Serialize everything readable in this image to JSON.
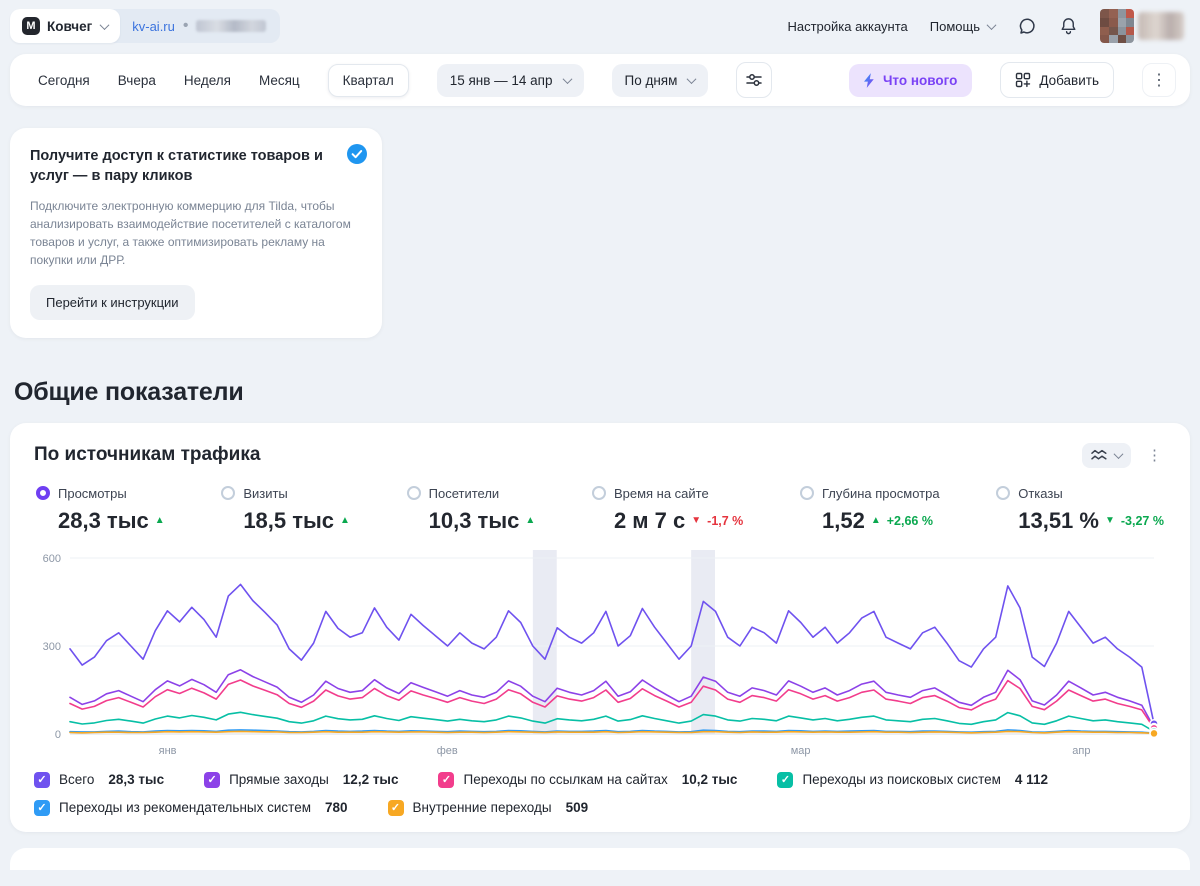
{
  "topbar": {
    "counter_name": "Ковчег",
    "logo_letter": "М",
    "site": "kv-ai.ru",
    "separator": "•",
    "account_settings": "Настройка аккаунта",
    "help": "Помощь"
  },
  "toolbar": {
    "periods": [
      "Сегодня",
      "Вчера",
      "Неделя",
      "Месяц",
      "Квартал"
    ],
    "active_period": "Квартал",
    "date_range": "15 янв — 14 апр",
    "granularity": "По дням",
    "whats_new": "Что нового",
    "add": "Добавить"
  },
  "promo": {
    "title": "Получите доступ к статистике товаров и услуг — в пару кликов",
    "body": "Подключите электронную коммерцию для Tilda, чтобы анализировать взаимодействие посетителей с каталогом товаров и услуг, а также оптимизировать рекламу на покупки или ДРР.",
    "button": "Перейти к инструкции"
  },
  "section_title": "Общие показатели",
  "widget": {
    "title": "По источникам трафика",
    "metrics": [
      {
        "label": "Просмотры",
        "value": "28,3 тыс",
        "trend": "up",
        "trend_color": "green",
        "delta": "",
        "selected": true
      },
      {
        "label": "Визиты",
        "value": "18,5 тыс",
        "trend": "up",
        "trend_color": "green",
        "delta": "",
        "selected": false
      },
      {
        "label": "Посетители",
        "value": "10,3 тыс",
        "trend": "up",
        "trend_color": "green",
        "delta": "",
        "selected": false
      },
      {
        "label": "Время на сайте",
        "value": "2 м 7 с",
        "trend": "down",
        "trend_color": "red",
        "delta": "-1,7 %",
        "selected": false
      },
      {
        "label": "Глубина просмотра",
        "value": "1,52",
        "trend": "up",
        "trend_color": "green",
        "delta": "+2,66 %",
        "selected": false
      },
      {
        "label": "Отказы",
        "value": "13,51 %",
        "trend": "down",
        "trend_color": "green",
        "delta": "-3,27 %",
        "selected": false
      }
    ]
  },
  "chart_data": {
    "type": "line",
    "title": "По источникам трафика",
    "x_range_label": "15 янв — 14 апр",
    "x_unit": "day",
    "ylim": [
      0,
      600
    ],
    "yticks": [
      0,
      300,
      600
    ],
    "grid": true,
    "legend_position": "bottom",
    "x_labels": [
      {
        "label": "янв",
        "pos": 0.09
      },
      {
        "label": "фев",
        "pos": 0.348
      },
      {
        "label": "мар",
        "pos": 0.674
      },
      {
        "label": "апр",
        "pos": 0.933
      }
    ],
    "holiday_bands": [
      [
        0.427,
        0.449
      ],
      [
        0.573,
        0.595
      ]
    ],
    "series": [
      {
        "name": "Всего",
        "total": "28,3 тыс",
        "color": "#6f52ef",
        "values": [
          290,
          235,
          262,
          318,
          345,
          300,
          255,
          352,
          420,
          382,
          432,
          390,
          330,
          470,
          510,
          455,
          415,
          372,
          290,
          252,
          310,
          418,
          360,
          330,
          345,
          430,
          364,
          320,
          408,
          370,
          335,
          300,
          345,
          310,
          290,
          330,
          420,
          380,
          300,
          255,
          362,
          330,
          310,
          345,
          418,
          300,
          335,
          428,
          364,
          310,
          255,
          300,
          452,
          418,
          330,
          300,
          364,
          345,
          310,
          420,
          380,
          330,
          364,
          310,
          345,
          395,
          418,
          330,
          310,
          290,
          345,
          364,
          310,
          250,
          228,
          290,
          330,
          505,
          430,
          262,
          230,
          310,
          418,
          364,
          310,
          330,
          290,
          262,
          228,
          35
        ]
      },
      {
        "name": "Прямые заходы",
        "total": "12,2 тыс",
        "color": "#8c42e8",
        "values": [
          125,
          101,
          113,
          137,
          148,
          129,
          110,
          151,
          181,
          164,
          186,
          168,
          142,
          202,
          219,
          196,
          178,
          160,
          125,
          108,
          133,
          180,
          155,
          142,
          148,
          185,
          157,
          138,
          175,
          159,
          144,
          129,
          148,
          133,
          125,
          142,
          181,
          163,
          129,
          110,
          156,
          142,
          133,
          148,
          180,
          129,
          144,
          184,
          157,
          133,
          110,
          129,
          194,
          180,
          142,
          129,
          157,
          148,
          133,
          181,
          163,
          142,
          157,
          133,
          148,
          170,
          180,
          142,
          133,
          125,
          148,
          157,
          133,
          108,
          98,
          125,
          142,
          217,
          185,
          113,
          99,
          133,
          180,
          157,
          133,
          142,
          125,
          113,
          98,
          22
        ]
      },
      {
        "name": "Переходы по ссылкам на сайтах",
        "total": "10,2 тыс",
        "color": "#f23d8c",
        "values": [
          104,
          85,
          94,
          114,
          124,
          108,
          92,
          127,
          151,
          138,
          156,
          140,
          119,
          169,
          184,
          164,
          149,
          134,
          104,
          91,
          112,
          150,
          130,
          119,
          124,
          155,
          131,
          115,
          147,
          133,
          121,
          108,
          124,
          112,
          104,
          119,
          151,
          137,
          108,
          92,
          130,
          119,
          112,
          124,
          150,
          108,
          121,
          154,
          131,
          112,
          92,
          108,
          163,
          150,
          119,
          108,
          131,
          124,
          112,
          151,
          137,
          119,
          131,
          112,
          124,
          142,
          150,
          119,
          112,
          104,
          124,
          131,
          112,
          90,
          82,
          104,
          119,
          182,
          155,
          94,
          83,
          112,
          150,
          131,
          112,
          119,
          104,
          94,
          82,
          19
        ]
      },
      {
        "name": "Переходы из поисковых систем",
        "total": "4 112",
        "color": "#07bfa5",
        "values": [
          42,
          34,
          38,
          46,
          50,
          44,
          37,
          51,
          61,
          55,
          63,
          57,
          48,
          68,
          74,
          66,
          60,
          54,
          42,
          37,
          45,
          61,
          52,
          48,
          50,
          62,
          53,
          46,
          59,
          54,
          49,
          44,
          50,
          45,
          42,
          48,
          61,
          55,
          44,
          37,
          52,
          48,
          45,
          50,
          61,
          44,
          49,
          62,
          53,
          45,
          37,
          44,
          66,
          61,
          48,
          44,
          53,
          50,
          45,
          61,
          55,
          48,
          53,
          45,
          50,
          57,
          61,
          48,
          45,
          42,
          50,
          53,
          45,
          36,
          33,
          42,
          48,
          73,
          62,
          38,
          33,
          45,
          61,
          53,
          45,
          48,
          42,
          38,
          33,
          9
        ]
      },
      {
        "name": "Переходы из рекомендательных систем",
        "total": "780",
        "color": "#2f9bf5",
        "values": [
          8,
          7,
          7,
          9,
          10,
          8,
          7,
          10,
          12,
          11,
          12,
          11,
          9,
          13,
          14,
          13,
          12,
          10,
          8,
          7,
          9,
          12,
          10,
          9,
          10,
          12,
          10,
          9,
          11,
          10,
          9,
          8,
          10,
          9,
          8,
          9,
          12,
          11,
          9,
          7,
          10,
          9,
          9,
          10,
          12,
          8,
          9,
          12,
          10,
          9,
          7,
          8,
          13,
          12,
          9,
          8,
          10,
          10,
          9,
          12,
          11,
          9,
          10,
          9,
          10,
          11,
          12,
          9,
          9,
          8,
          10,
          10,
          9,
          7,
          6,
          8,
          9,
          14,
          12,
          7,
          6,
          9,
          12,
          10,
          9,
          9,
          8,
          7,
          6,
          3
        ]
      },
      {
        "name": "Внутренние переходы",
        "total": "509",
        "color": "#f7a823",
        "values": [
          5,
          4,
          5,
          6,
          6,
          5,
          5,
          6,
          8,
          7,
          8,
          7,
          6,
          8,
          9,
          8,
          7,
          7,
          5,
          5,
          6,
          8,
          6,
          6,
          6,
          8,
          7,
          6,
          7,
          7,
          6,
          5,
          6,
          6,
          5,
          6,
          8,
          7,
          6,
          5,
          7,
          6,
          6,
          6,
          8,
          5,
          6,
          8,
          7,
          6,
          5,
          5,
          8,
          8,
          6,
          5,
          7,
          6,
          6,
          8,
          7,
          6,
          7,
          6,
          6,
          7,
          8,
          6,
          6,
          5,
          6,
          7,
          6,
          5,
          4,
          5,
          6,
          9,
          8,
          5,
          4,
          6,
          8,
          7,
          6,
          6,
          5,
          5,
          4,
          2
        ]
      }
    ]
  }
}
